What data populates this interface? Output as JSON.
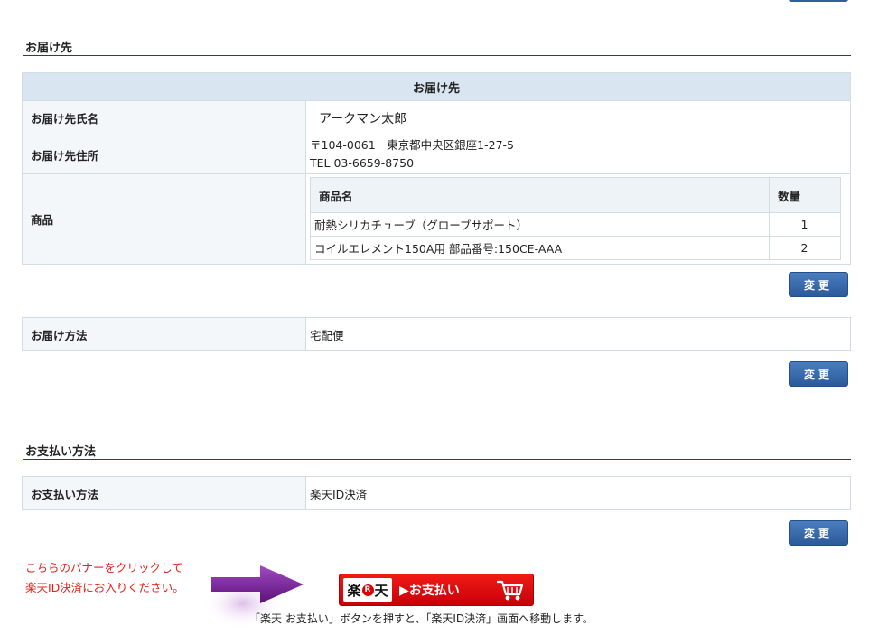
{
  "delivery_section": {
    "title": "お届け先",
    "table_caption": "お届け先",
    "name_label": "お届け先氏名",
    "name_value": "アークマン太郎",
    "address_label": "お届け先住所",
    "address_line": "〒104-0061　東京都中央区銀座1-27-5",
    "tel_line": "TEL 03-6659-8750",
    "product_label": "商品",
    "items_headers": [
      "商品名",
      "数量"
    ],
    "items": [
      {
        "name": "耐熱シリカチューブ（グローブサポート）",
        "qty": "1"
      },
      {
        "name": "コイルエレメント150A用 部品番号:150CE-AAA",
        "qty": "2"
      }
    ],
    "change_label": "変更"
  },
  "shipping": {
    "method_label": "お届け方法",
    "method_value": "宅配便",
    "change_label": "変更"
  },
  "payment_section": {
    "title": "お支払い方法",
    "method_label": "お支払い方法",
    "method_value": "楽天ID決済",
    "change_label": "変更"
  },
  "promo": {
    "line1": "こちらのバナーをクリックして",
    "line2": "楽天ID決済にお入りください。",
    "banner_logo_left": "楽",
    "banner_logo_r": "R",
    "banner_logo_right": "天",
    "banner_label": "▶お支払い",
    "note": "「楽天 お支払い」ボタンを押すと、「楽天ID決済」画面へ移動します。"
  },
  "colors": {
    "accent_blue": "#2b5a99",
    "label_bg": "#f3f7fa",
    "caption_bg": "#d9e6f1",
    "promo_red": "#e0231a",
    "arrow_purple": "#7a1fa0"
  },
  "icons": {
    "arrow": "right-arrow-icon",
    "cart": "shopping-cart-icon"
  }
}
